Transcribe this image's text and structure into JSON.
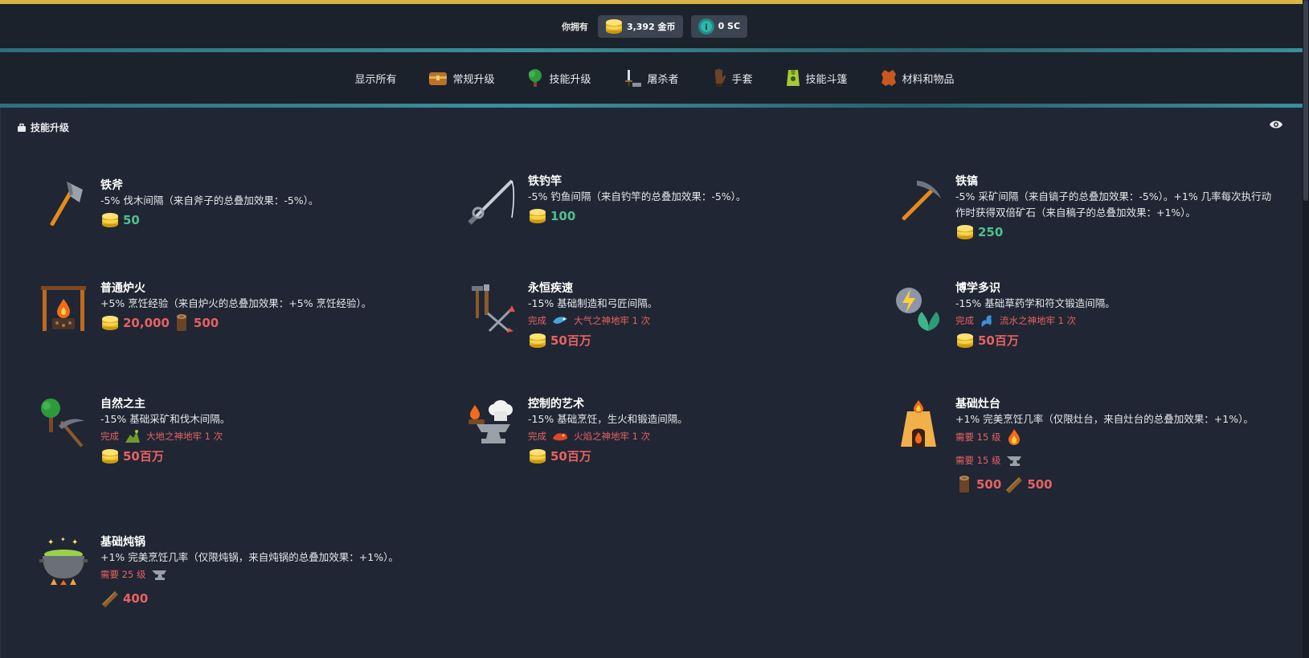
{
  "wallet": {
    "label": "你拥有",
    "gold": "3,392 金币",
    "sc": "0 SC"
  },
  "nav": [
    {
      "label": "显示所有",
      "icon": "none"
    },
    {
      "label": "常规升级",
      "icon": "chest-icon"
    },
    {
      "label": "技能升级",
      "icon": "tree-icon"
    },
    {
      "label": "屠杀者",
      "icon": "sword-icon"
    },
    {
      "label": "手套",
      "icon": "glove-icon"
    },
    {
      "label": "技能斗篷",
      "icon": "cape-icon"
    },
    {
      "label": "材料和物品",
      "icon": "leather-icon"
    }
  ],
  "section": {
    "title": "技能升级"
  },
  "upgrades": {
    "iron_axe": {
      "name": "铁斧",
      "desc": "-5% 伐木间隔（来自斧子的总叠加效果：-5%）。",
      "gold": "50"
    },
    "iron_rod": {
      "name": "铁钓竿",
      "desc": "-5% 钓鱼间隔（来自钓竿的总叠加效果：-5%）。",
      "gold": "100"
    },
    "iron_pick": {
      "name": "铁镐",
      "desc": "-5% 采矿间隔（来自镐子的总叠加效果：-5%）。+1% 几率每次执行动作时获得双倍矿石（来自稿子的总叠加效果：+1%）。",
      "gold": "250"
    },
    "campfire": {
      "name": "普通炉火",
      "desc": "+5% 烹饪经验（来自炉火的总叠加效果：+5% 烹饪经验）。",
      "gold": "20,000",
      "logs": "500"
    },
    "eternal_haste": {
      "name": "永恒疾速",
      "desc": "-15% 基础制造和弓匠间隔。",
      "done": "完成",
      "dungeon": "大气之神地牢 1 次",
      "gold": "50百万"
    },
    "polymath": {
      "name": "博学多识",
      "desc": "-15% 基础草药学和符文锻造间隔。",
      "done": "完成",
      "dungeon": "流水之神地牢 1 次",
      "gold": "50百万"
    },
    "nature_lord": {
      "name": "自然之主",
      "desc": "-15% 基础采矿和伐木间隔。",
      "done": "完成",
      "dungeon": "大地之神地牢 1 次",
      "gold": "50百万"
    },
    "art_control": {
      "name": "控制的艺术",
      "desc": "-15% 基础烹饪，生火和锻造间隔。",
      "done": "完成",
      "dungeon": "火焰之神地牢 1 次",
      "gold": "50百万"
    },
    "basic_stove": {
      "name": "基础灶台",
      "desc": "+1% 完美烹饪几率（仅限灶台，来自灶台的总叠加效果：+1%）。",
      "req1": "需要 15 级",
      "req2": "需要 15 级",
      "logs": "500",
      "planks": "500"
    },
    "basic_pot": {
      "name": "基础炖锅",
      "desc": "+1% 完美烹饪几率（仅限炖锅，来自炖锅的总叠加效果：+1%）。",
      "req1": "需要 25 级",
      "planks": "400"
    }
  },
  "colors": {
    "affordable": "#4cc190",
    "unaffordable": "#e66262",
    "accent": "#d9b545"
  }
}
